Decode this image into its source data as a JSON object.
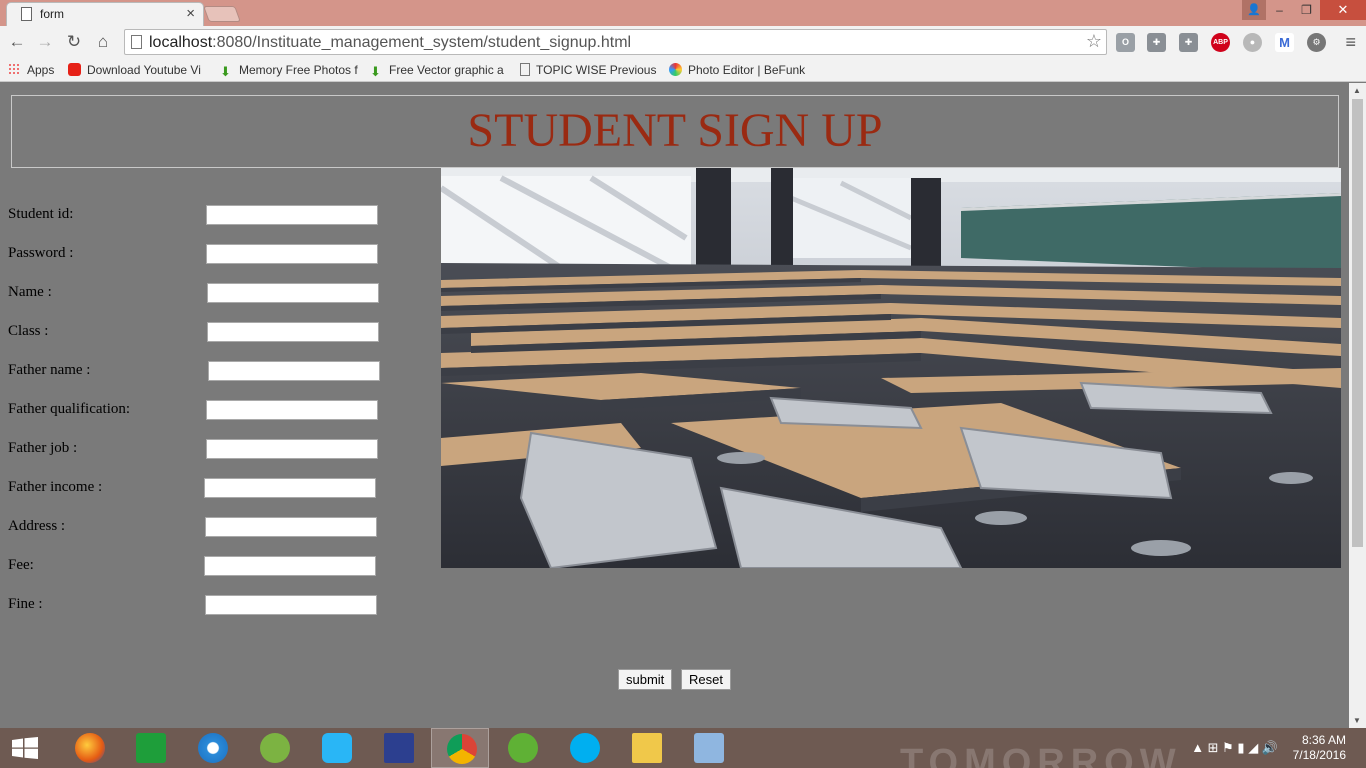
{
  "browser": {
    "tab_title": "form",
    "tab_close": "×",
    "url_host": "localhost",
    "url_rest": ":8080/Instituate_management_system/student_signup.html",
    "window_buttons": {
      "minimize": "–",
      "restore": "❐",
      "close": "✕"
    },
    "extensions": [
      "abp-icon",
      "gmail-icon",
      "settings-icon"
    ],
    "abp_label": "ABP"
  },
  "bookmarks": [
    {
      "label": "Apps",
      "icon": "apps-grid-icon"
    },
    {
      "label": "Download Youtube Vi",
      "icon": "youtube-icon"
    },
    {
      "label": "Memory Free Photos f",
      "icon": "download-arrow-icon"
    },
    {
      "label": "Free Vector graphic a",
      "icon": "download-arrow-icon"
    },
    {
      "label": "TOPIC WISE Previous",
      "icon": "page-icon"
    },
    {
      "label": "Photo Editor | BeFunk",
      "icon": "befunky-icon"
    }
  ],
  "page": {
    "heading": "STUDENT SIGN UP",
    "fields": [
      {
        "label": "Student id:",
        "value": ""
      },
      {
        "label": "Password :",
        "value": ""
      },
      {
        "label": "Name :",
        "value": ""
      },
      {
        "label": "Class :",
        "value": ""
      },
      {
        "label": "Father name :",
        "value": ""
      },
      {
        "label": "Father qualification:",
        "value": ""
      },
      {
        "label": "Father job :",
        "value": ""
      },
      {
        "label": "Father income :",
        "value": ""
      },
      {
        "label": "Address :",
        "value": ""
      },
      {
        "label": "Fee:",
        "value": ""
      },
      {
        "label": "Fine :",
        "value": ""
      }
    ],
    "submit_label": "submit",
    "reset_label": "Reset"
  },
  "taskbar": {
    "apps": [
      "firefox-icon",
      "store-icon",
      "ie-icon",
      "android-studio-icon",
      "sync-icon",
      "devcpp-icon",
      "chrome-icon",
      "utorrent-icon",
      "skype-icon",
      "folder-icon",
      "virtualbox-icon"
    ],
    "time": "8:36 AM",
    "date": "7/18/2016"
  },
  "colors": {
    "heading": "#9a2a12",
    "page_bg": "#7a7a7a",
    "titlebar": "#d4958a"
  }
}
